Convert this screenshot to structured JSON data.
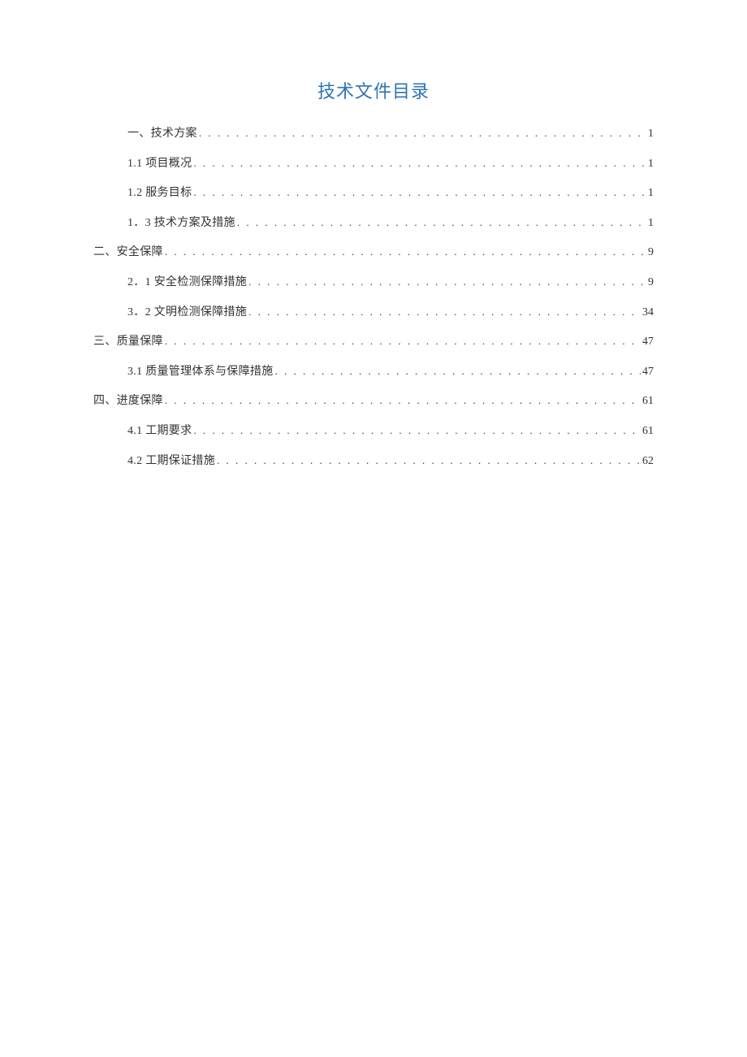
{
  "title": "技术文件目录",
  "toc": [
    {
      "level": 2,
      "label": "一、技术方案 ",
      "page": "1"
    },
    {
      "level": 2,
      "label": "1.1 项目概况 ",
      "page": "1"
    },
    {
      "level": 2,
      "label": "1.2 服务目标 ",
      "page": "1"
    },
    {
      "level": 2,
      "label": "1．3 技术方案及措施",
      "page": "1"
    },
    {
      "level": 1,
      "label": "二、安全保障",
      "page": "9"
    },
    {
      "level": 2,
      "label": "2．1 安全检测保障措施 ",
      "page": "9"
    },
    {
      "level": 2,
      "label": "3．2 文明检测保障措施 ",
      "page": "34"
    },
    {
      "level": 1,
      "label": "三、质量保障",
      "page": "47"
    },
    {
      "level": 2,
      "label": "3.1 质量管理体系与保障措施 ",
      "page": "47"
    },
    {
      "level": 1,
      "label": "四、进度保障",
      "page": "61"
    },
    {
      "level": 2,
      "label": "4.1 工期要求 ",
      "page": "61"
    },
    {
      "level": 2,
      "label": "4.2 工期保证措施 ",
      "page": "62"
    }
  ]
}
